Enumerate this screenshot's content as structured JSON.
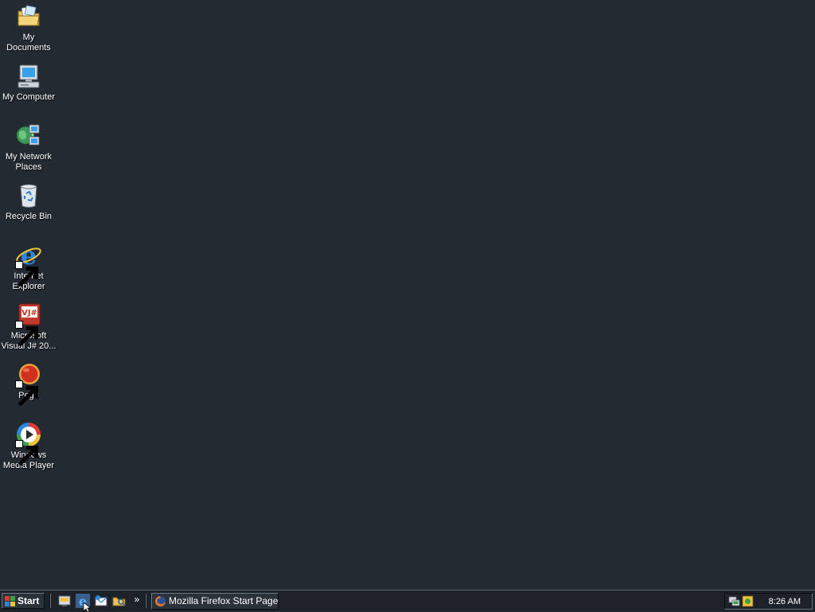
{
  "desktop": {
    "icons": [
      {
        "label": "My Documents",
        "icon": "my-documents-icon"
      },
      {
        "label": "My Computer",
        "icon": "my-computer-icon"
      },
      {
        "label": "My Network\nPlaces",
        "icon": "my-network-places-icon"
      },
      {
        "label": "Recycle Bin",
        "icon": "recycle-bin-icon"
      },
      {
        "label": "Internet\nExplorer",
        "icon": "internet-explorer-icon"
      },
      {
        "label": "Microsoft\nVisual J# 20...",
        "icon": "visual-jsharp-icon"
      },
      {
        "label": "Pego",
        "icon": "pego-icon"
      },
      {
        "label": "Windows\nMedia Player",
        "icon": "windows-media-player-icon"
      }
    ]
  },
  "taskbar": {
    "start_label": "Start",
    "quick_launch": [
      "show-desktop-icon",
      "internet-explorer-icon",
      "outlook-express-icon",
      "windows-explorer-icon"
    ],
    "more_label": "»",
    "tasks": [
      {
        "label": "Mozilla Firefox Start Page...",
        "icon": "firefox-icon"
      }
    ],
    "tray": {
      "icons": [
        "network-icon",
        "security-icon"
      ],
      "clock": "8:26 AM"
    }
  },
  "colors": {
    "desktop_background": "#232a32",
    "taskbar_background": "#1d2228",
    "text": "#ffffff"
  }
}
